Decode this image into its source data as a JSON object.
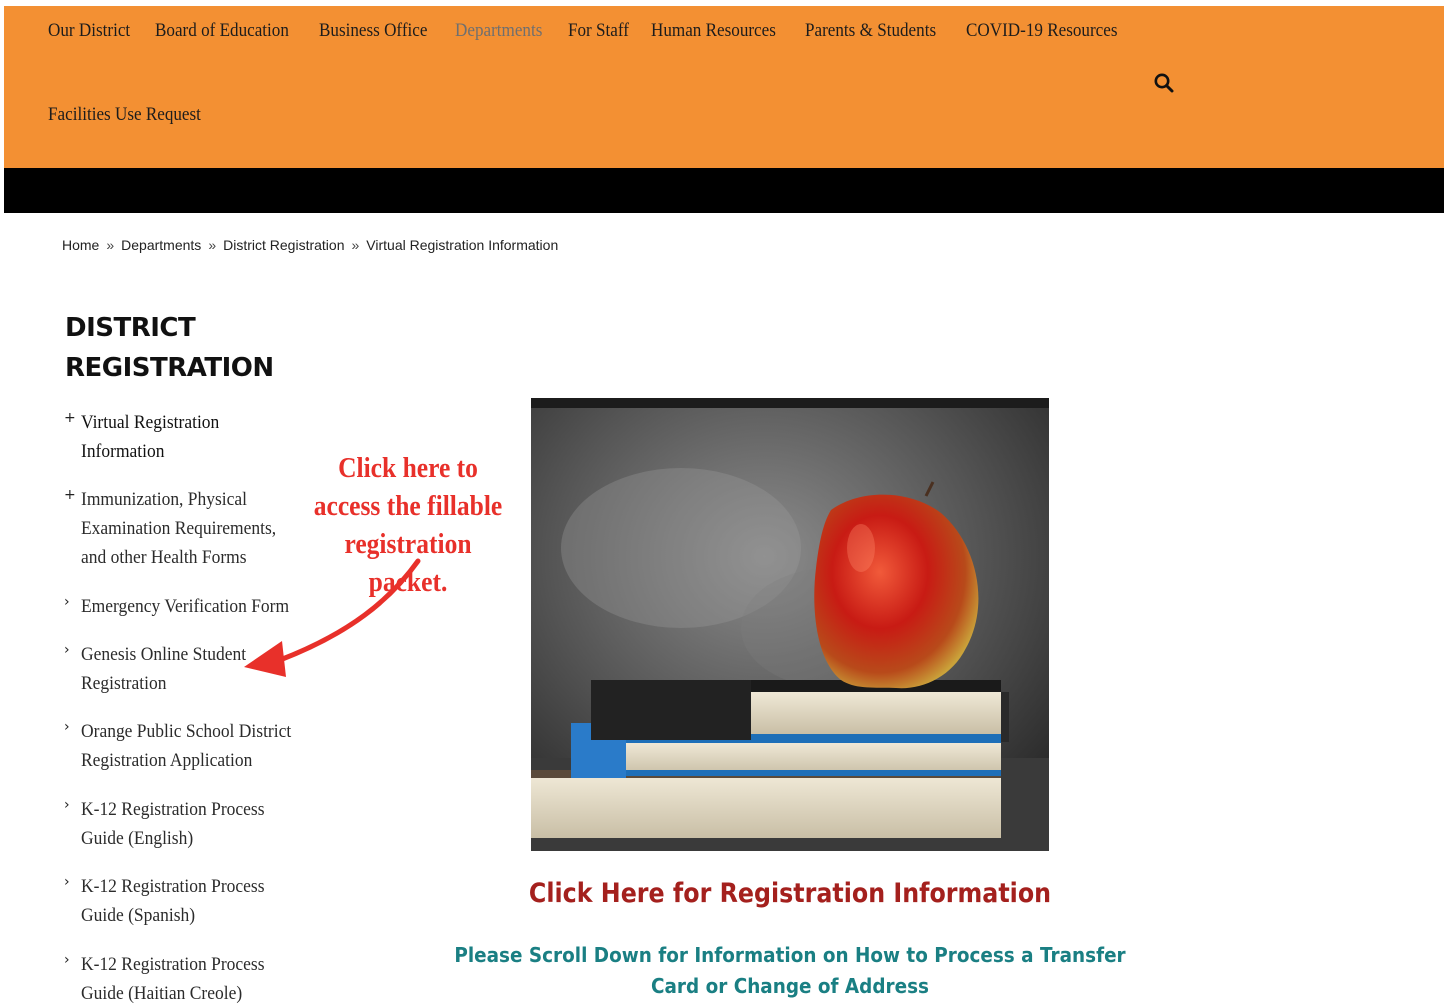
{
  "nav": {
    "items": [
      {
        "label": "Our District",
        "active": false
      },
      {
        "label": "Board of Education",
        "active": false
      },
      {
        "label": "Business Office",
        "active": false
      },
      {
        "label": "Departments",
        "active": true
      },
      {
        "label": "For Staff",
        "active": false
      },
      {
        "label": "Human Resources",
        "active": false
      },
      {
        "label": "Parents & Students",
        "active": false
      },
      {
        "label": "COVID-19 Resources",
        "active": false
      }
    ],
    "second_row": "Facilities Use Request",
    "search_icon": "search-icon"
  },
  "colors": {
    "nav_bg": "#f39033",
    "bar": "#000000",
    "annotation": "#e8302a",
    "reg_link": "#a4201d",
    "scroll_note": "#1a7f83"
  },
  "breadcrumb": {
    "items": [
      "Home",
      "Departments",
      "District Registration",
      "Virtual Registration Information"
    ],
    "separator": "»"
  },
  "sidebar": {
    "title_line1": "DISTRICT",
    "title_line2": "REGISTRATION",
    "items": [
      {
        "marker": "+",
        "label": "Virtual Registration Information"
      },
      {
        "marker": "+",
        "label": "Immunization, Physical Examination Requirements, and other Health Forms"
      },
      {
        "marker": "›",
        "label": "Emergency Verification Form"
      },
      {
        "marker": "›",
        "label": "Genesis Online Student Registration"
      },
      {
        "marker": "›",
        "label": "Orange Public School District Registration Application"
      },
      {
        "marker": "›",
        "label": "K-12 Registration Process Guide (English)"
      },
      {
        "marker": "›",
        "label": "K-12 Registration Process Guide (Spanish)"
      },
      {
        "marker": "›",
        "label": "K-12 Registration Process Guide (Haitian Creole)"
      }
    ]
  },
  "annotation": {
    "text": "Click here to access the fillable registration packet."
  },
  "main": {
    "image_alt": "apple on books",
    "registration_link": "Click Here for Registration Information",
    "scroll_note": "Please Scroll Down for Information on How to Process a Transfer Card or Change of Address"
  }
}
